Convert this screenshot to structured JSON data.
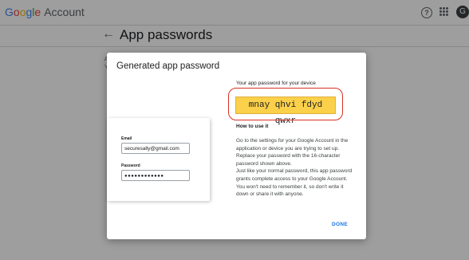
{
  "header": {
    "logo_g": "G",
    "logo_o1": "o",
    "logo_o2": "o",
    "logo_g2": "g",
    "logo_l": "l",
    "logo_e": "e",
    "logo_account": "Account",
    "help_icon": "help-circle-icon",
    "apps_icon": "apps-grid-icon",
    "avatar_letter": "G"
  },
  "page": {
    "title": "App passwords",
    "back_icon": "arrow-back-icon",
    "bg_line1": "A",
    "bg_line2": "Y"
  },
  "dialog": {
    "title": "Generated app password",
    "password_heading": "Your app password for your device",
    "password": "mnay qhvi fdyd qwxr",
    "howto_heading": "How to use it",
    "howto_p1": "Go to the settings for your Google Account in the application or device you are trying to set up. Replace your password with the 16-character password shown above.",
    "howto_p2": "Just like your normal password, this app password grants complete access to your Google Account. You won't need to remember it, so don't write it down or share it with anyone.",
    "done_label": "DONE",
    "illustration": {
      "email_label": "Email",
      "email_value": "securesally@gmail.com",
      "password_label": "Password",
      "password_value": "●●●●●●●●●●●●"
    }
  },
  "colors": {
    "accent": "#1a73e8",
    "highlight": "#fbd04a",
    "circle": "#d93025"
  }
}
